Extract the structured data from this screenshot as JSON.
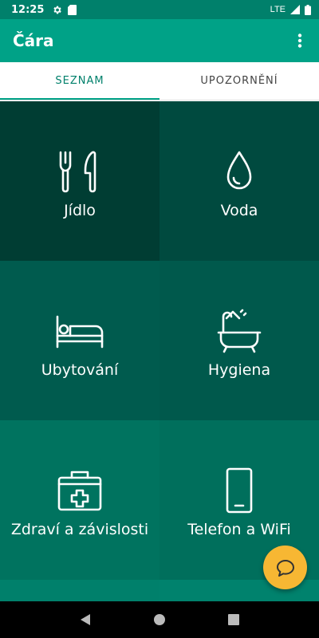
{
  "status_bar": {
    "time": "12:25",
    "network": "LTE"
  },
  "app_bar": {
    "title": "Čára"
  },
  "tabs": [
    {
      "label": "SEZNAM",
      "active": true
    },
    {
      "label": "UPOZORNĚNÍ",
      "active": false
    }
  ],
  "categories": [
    {
      "label": "Jídlo",
      "icon": "fork-knife-icon",
      "color": "#003d33"
    },
    {
      "label": "Voda",
      "icon": "water-drop-icon",
      "color": "#004a3f"
    },
    {
      "label": "Ubytování",
      "icon": "bed-icon",
      "color": "#005b4e"
    },
    {
      "label": "Hygiena",
      "icon": "bathtub-shower-icon",
      "color": "#00594c"
    },
    {
      "label": "Zdraví a závislosti",
      "icon": "first-aid-kit-icon",
      "color": "#00735f"
    },
    {
      "label": "Telefon a WiFi",
      "icon": "phone-icon",
      "color": "#006f5c"
    }
  ],
  "fab": {
    "icon": "chat-bubble-icon",
    "color": "#f7b733"
  },
  "colors": {
    "status_bar": "#00806b",
    "app_bar": "#00a287",
    "tab_accent": "#00806b"
  }
}
